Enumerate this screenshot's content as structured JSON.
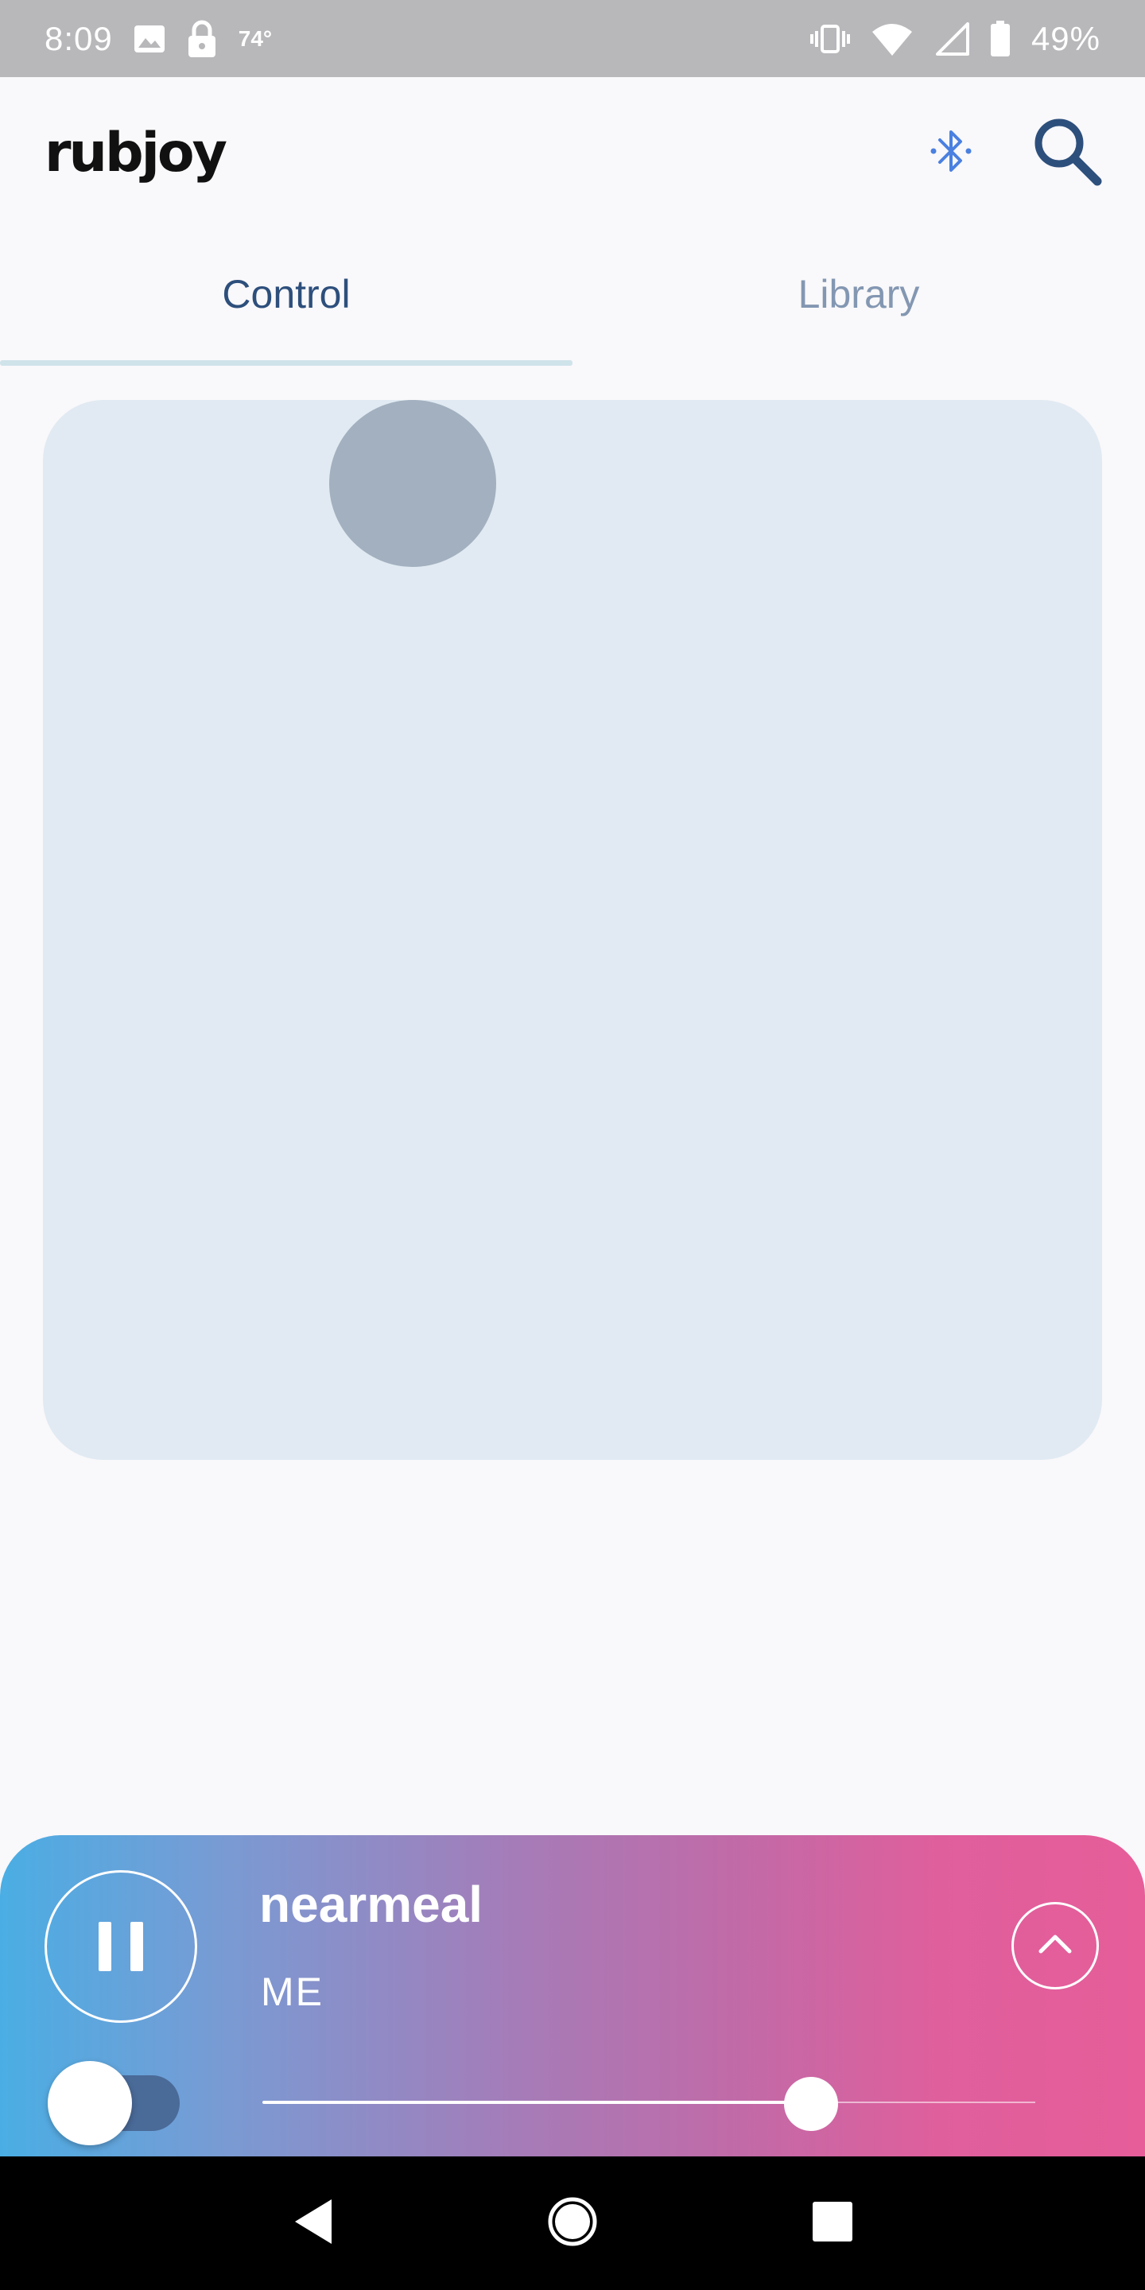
{
  "status_bar": {
    "time": "8:09",
    "temperature": "74°",
    "battery_percent": "49%",
    "icons": [
      "image-icon",
      "lock-icon",
      "vibrate-icon",
      "wifi-icon",
      "signal-icon",
      "battery-icon"
    ]
  },
  "app_bar": {
    "brand": "rubjoy",
    "actions": [
      "bluetooth-icon",
      "search-icon"
    ],
    "bluetooth_color": "#4a80e0",
    "search_color": "#2d4f7c"
  },
  "tabs": [
    {
      "label": "Control",
      "selected": true
    },
    {
      "label": "Library",
      "selected": false
    }
  ],
  "player": {
    "title": "nearmeal",
    "artist": "ME",
    "state": "playing",
    "toggle_on": false,
    "slider_value_fraction": 0.71,
    "gradient_colors": [
      "#4aaee4",
      "#a57cb8",
      "#e65d9a"
    ]
  },
  "nav_bar": {
    "buttons": [
      "back-icon",
      "home-icon",
      "recents-icon"
    ]
  }
}
